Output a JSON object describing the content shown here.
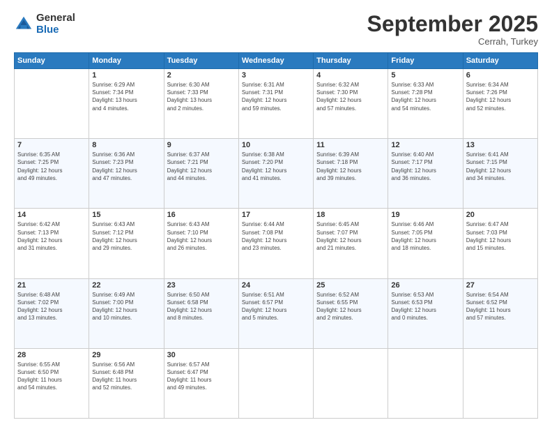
{
  "logo": {
    "general": "General",
    "blue": "Blue"
  },
  "header": {
    "month": "September 2025",
    "location": "Cerrah, Turkey"
  },
  "weekdays": [
    "Sunday",
    "Monday",
    "Tuesday",
    "Wednesday",
    "Thursday",
    "Friday",
    "Saturday"
  ],
  "weeks": [
    [
      {
        "day": "",
        "info": ""
      },
      {
        "day": "1",
        "info": "Sunrise: 6:29 AM\nSunset: 7:34 PM\nDaylight: 13 hours\nand 4 minutes."
      },
      {
        "day": "2",
        "info": "Sunrise: 6:30 AM\nSunset: 7:33 PM\nDaylight: 13 hours\nand 2 minutes."
      },
      {
        "day": "3",
        "info": "Sunrise: 6:31 AM\nSunset: 7:31 PM\nDaylight: 12 hours\nand 59 minutes."
      },
      {
        "day": "4",
        "info": "Sunrise: 6:32 AM\nSunset: 7:30 PM\nDaylight: 12 hours\nand 57 minutes."
      },
      {
        "day": "5",
        "info": "Sunrise: 6:33 AM\nSunset: 7:28 PM\nDaylight: 12 hours\nand 54 minutes."
      },
      {
        "day": "6",
        "info": "Sunrise: 6:34 AM\nSunset: 7:26 PM\nDaylight: 12 hours\nand 52 minutes."
      }
    ],
    [
      {
        "day": "7",
        "info": "Sunrise: 6:35 AM\nSunset: 7:25 PM\nDaylight: 12 hours\nand 49 minutes."
      },
      {
        "day": "8",
        "info": "Sunrise: 6:36 AM\nSunset: 7:23 PM\nDaylight: 12 hours\nand 47 minutes."
      },
      {
        "day": "9",
        "info": "Sunrise: 6:37 AM\nSunset: 7:21 PM\nDaylight: 12 hours\nand 44 minutes."
      },
      {
        "day": "10",
        "info": "Sunrise: 6:38 AM\nSunset: 7:20 PM\nDaylight: 12 hours\nand 41 minutes."
      },
      {
        "day": "11",
        "info": "Sunrise: 6:39 AM\nSunset: 7:18 PM\nDaylight: 12 hours\nand 39 minutes."
      },
      {
        "day": "12",
        "info": "Sunrise: 6:40 AM\nSunset: 7:17 PM\nDaylight: 12 hours\nand 36 minutes."
      },
      {
        "day": "13",
        "info": "Sunrise: 6:41 AM\nSunset: 7:15 PM\nDaylight: 12 hours\nand 34 minutes."
      }
    ],
    [
      {
        "day": "14",
        "info": "Sunrise: 6:42 AM\nSunset: 7:13 PM\nDaylight: 12 hours\nand 31 minutes."
      },
      {
        "day": "15",
        "info": "Sunrise: 6:43 AM\nSunset: 7:12 PM\nDaylight: 12 hours\nand 29 minutes."
      },
      {
        "day": "16",
        "info": "Sunrise: 6:43 AM\nSunset: 7:10 PM\nDaylight: 12 hours\nand 26 minutes."
      },
      {
        "day": "17",
        "info": "Sunrise: 6:44 AM\nSunset: 7:08 PM\nDaylight: 12 hours\nand 23 minutes."
      },
      {
        "day": "18",
        "info": "Sunrise: 6:45 AM\nSunset: 7:07 PM\nDaylight: 12 hours\nand 21 minutes."
      },
      {
        "day": "19",
        "info": "Sunrise: 6:46 AM\nSunset: 7:05 PM\nDaylight: 12 hours\nand 18 minutes."
      },
      {
        "day": "20",
        "info": "Sunrise: 6:47 AM\nSunset: 7:03 PM\nDaylight: 12 hours\nand 15 minutes."
      }
    ],
    [
      {
        "day": "21",
        "info": "Sunrise: 6:48 AM\nSunset: 7:02 PM\nDaylight: 12 hours\nand 13 minutes."
      },
      {
        "day": "22",
        "info": "Sunrise: 6:49 AM\nSunset: 7:00 PM\nDaylight: 12 hours\nand 10 minutes."
      },
      {
        "day": "23",
        "info": "Sunrise: 6:50 AM\nSunset: 6:58 PM\nDaylight: 12 hours\nand 8 minutes."
      },
      {
        "day": "24",
        "info": "Sunrise: 6:51 AM\nSunset: 6:57 PM\nDaylight: 12 hours\nand 5 minutes."
      },
      {
        "day": "25",
        "info": "Sunrise: 6:52 AM\nSunset: 6:55 PM\nDaylight: 12 hours\nand 2 minutes."
      },
      {
        "day": "26",
        "info": "Sunrise: 6:53 AM\nSunset: 6:53 PM\nDaylight: 12 hours\nand 0 minutes."
      },
      {
        "day": "27",
        "info": "Sunrise: 6:54 AM\nSunset: 6:52 PM\nDaylight: 11 hours\nand 57 minutes."
      }
    ],
    [
      {
        "day": "28",
        "info": "Sunrise: 6:55 AM\nSunset: 6:50 PM\nDaylight: 11 hours\nand 54 minutes."
      },
      {
        "day": "29",
        "info": "Sunrise: 6:56 AM\nSunset: 6:48 PM\nDaylight: 11 hours\nand 52 minutes."
      },
      {
        "day": "30",
        "info": "Sunrise: 6:57 AM\nSunset: 6:47 PM\nDaylight: 11 hours\nand 49 minutes."
      },
      {
        "day": "",
        "info": ""
      },
      {
        "day": "",
        "info": ""
      },
      {
        "day": "",
        "info": ""
      },
      {
        "day": "",
        "info": ""
      }
    ]
  ]
}
